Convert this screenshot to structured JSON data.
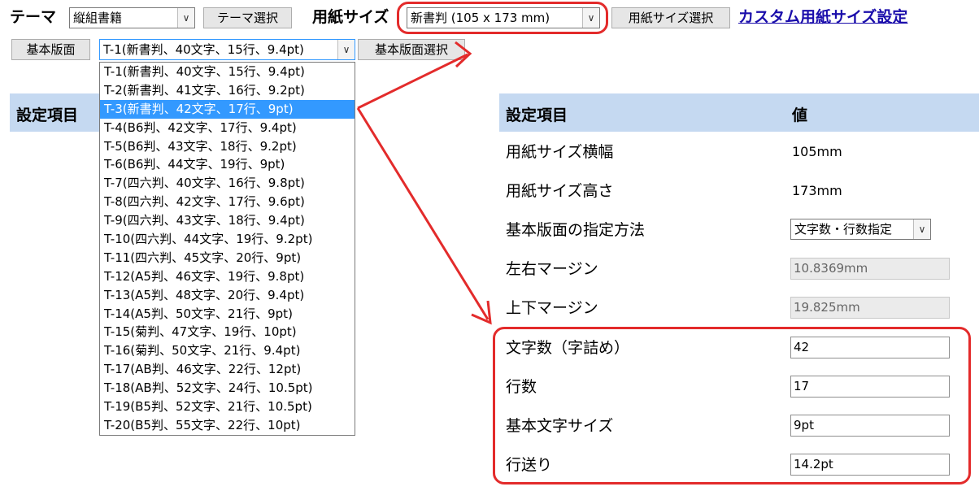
{
  "theme": {
    "label": "テーマ",
    "value": "縦組書籍",
    "button": "テーマ選択"
  },
  "paper": {
    "label": "用紙サイズ",
    "value": "新書判 (105 x 173 mm)",
    "button": "用紙サイズ選択",
    "custom_link": "カスタム用紙サイズ設定"
  },
  "layout": {
    "label": "基本版面",
    "value": "T-1(新書判、40文字、15行、9.4pt)",
    "button": "基本版面選択",
    "options": [
      "T-1(新書判、40文字、15行、9.4pt)",
      "T-2(新書判、41文字、16行、9.2pt)",
      "T-3(新書判、42文字、17行、9pt)",
      "T-4(B6判、42文字、17行、9.4pt)",
      "T-5(B6判、43文字、18行、9.2pt)",
      "T-6(B6判、44文字、19行、9pt)",
      "T-7(四六判、40文字、16行、9.8pt)",
      "T-8(四六判、42文字、17行、9.6pt)",
      "T-9(四六判、43文字、18行、9.4pt)",
      "T-10(四六判、44文字、19行、9.2pt)",
      "T-11(四六判、45文字、20行、9pt)",
      "T-12(A5判、46文字、19行、9.8pt)",
      "T-13(A5判、48文字、20行、9.4pt)",
      "T-14(A5判、50文字、21行、9pt)",
      "T-15(菊判、47文字、19行、10pt)",
      "T-16(菊判、50文字、21行、9.4pt)",
      "T-17(AB判、46文字、22行、12pt)",
      "T-18(AB判、52文字、24行、10.5pt)",
      "T-19(B5判、52文字、21行、10.5pt)",
      "T-20(B5判、55文字、22行、10pt)"
    ],
    "highlighted_index": 2
  },
  "left_table": {
    "header": "設定項目"
  },
  "table": {
    "header_item": "設定項目",
    "header_value": "値",
    "rows": [
      {
        "label": "用紙サイズ横幅",
        "value": "105mm"
      },
      {
        "label": "用紙サイズ高さ",
        "value": "173mm"
      },
      {
        "label": "基本版面の指定方法",
        "value": "文字数・行数指定"
      },
      {
        "label": "左右マージン",
        "value": "10.8369mm"
      },
      {
        "label": "上下マージン",
        "value": "19.825mm"
      },
      {
        "label": "文字数（字詰め）",
        "value": "42"
      },
      {
        "label": "行数",
        "value": "17"
      },
      {
        "label": "基本文字サイズ",
        "value": "9pt"
      },
      {
        "label": "行送り",
        "value": "14.2pt"
      }
    ]
  },
  "annotation_color": "#e32b2b",
  "icons": {
    "dropdown": "chevron-down-icon"
  }
}
